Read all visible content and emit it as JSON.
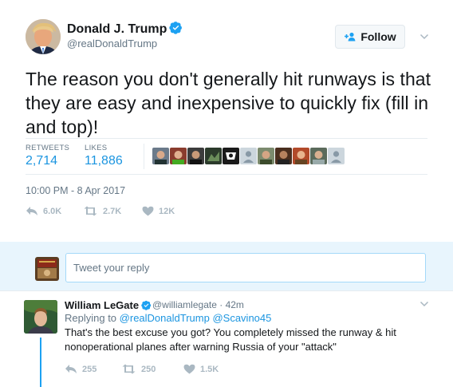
{
  "tweet": {
    "author_name": "Donald J. Trump",
    "author_handle": "@realDonaldTrump",
    "follow_label": "Follow",
    "text": "The reason you don't generally hit runways is that they are easy and inexpensive to quickly fix (fill in and top)!",
    "retweets_label": "RETWEETS",
    "retweets_value": "2,714",
    "likes_label": "LIKES",
    "likes_value": "11,886",
    "timestamp": "10:00 PM - 8 Apr 2017",
    "actions": {
      "reply_count": "6.0K",
      "retweet_count": "2.7K",
      "like_count": "12K"
    }
  },
  "reply_box": {
    "placeholder": "Tweet your reply"
  },
  "reply": {
    "author_name": "William LeGate",
    "author_handle": "@williamlegate",
    "time": "· 42m",
    "replying_prefix": "Replying to",
    "replying_to_1": "@realDonaldTrump",
    "replying_to_2": "@Scavino45",
    "text": "That's the best excuse you got? You completely missed the runway & hit nonoperational planes after warning Russia of your \"attack\"",
    "actions": {
      "reply_count": "255",
      "retweet_count": "250",
      "like_count": "1.5K"
    }
  },
  "colors": {
    "accent": "#1da1f2",
    "link": "#1b95e0",
    "muted": "#657786",
    "action_gray": "#aab8c2",
    "reply_area_bg": "#e8f5fd"
  },
  "icons": {
    "verified": "verified-badge-icon",
    "follow": "add-user-icon",
    "caret": "chevron-down-icon",
    "reply": "reply-arrow-icon",
    "retweet": "retweet-icon",
    "like": "heart-icon"
  }
}
